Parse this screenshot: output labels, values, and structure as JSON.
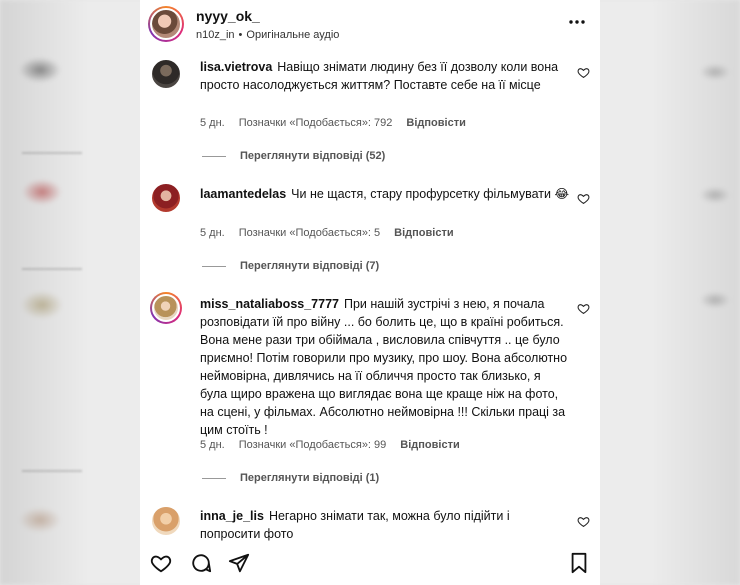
{
  "header": {
    "username": "nyyy_ok_",
    "sub_user": "n10z_in",
    "sub_dot": "•",
    "audio": "Оригінальне аудіо"
  },
  "comments": [
    {
      "user": "lisa.vietrova",
      "text": "Навіщо знімати людину без її дозволу коли вона просто насолоджується життям? Поставте себе на її місце",
      "time": "5 дн.",
      "likes": "Позначки «Подобається»: 792",
      "reply": "Відповісти",
      "view_replies": "Переглянути відповіді (52)"
    },
    {
      "user": "laamantedelas",
      "text": "Чи не щастя, стару профурсетку фільмувати 😂",
      "time": "5 дн.",
      "likes": "Позначки «Подобається»: 5",
      "reply": "Відповісти",
      "view_replies": "Переглянути відповіді (7)"
    },
    {
      "user": "miss_nataliaboss_7777",
      "text": "При нашій зустрічі з нею, я почала розповідати їй про війну ... бо болить це, що в країні робиться. Вона мене рази три обіймала , висловила співчуття .. це було приємно! Потім говорили про музику, про шоу. Вона абсолютно неймовірна, дивлячись на її обличчя просто так близько, я була щиро вражена що виглядає вона ще краще ніж на фото, на сцені, у фільмах. Абсолютно неймовірна !!! Скільки праці за цим стоїть !",
      "time": "5 дн.",
      "likes": "Позначки «Подобається»: 99",
      "reply": "Відповісти",
      "view_replies": "Переглянути відповіді (1)"
    },
    {
      "user": "inna_je_lis",
      "text": "Негарно знімати так, можна було підійти і попросити фото"
    }
  ],
  "icons": {
    "more": "more-options-icon",
    "heart": "heart-icon",
    "comment": "comment-icon",
    "share": "share-icon",
    "save": "bookmark-icon"
  }
}
